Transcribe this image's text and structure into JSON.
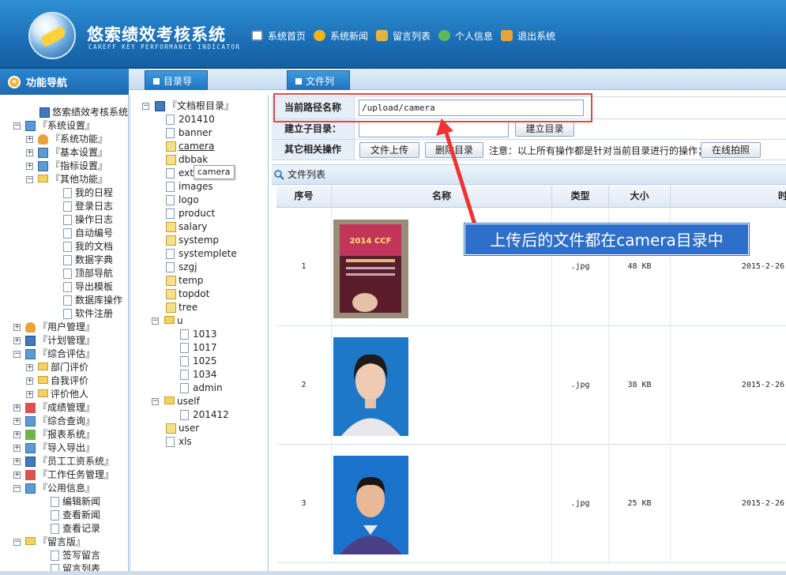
{
  "header": {
    "title": "悠索绩效考核系统",
    "subtitle": "CAREFF KEY PERFORMANCE INDICATOR",
    "nav": [
      {
        "label": "系统首页",
        "icon": "home-icon"
      },
      {
        "label": "系统新闻",
        "icon": "news-icon"
      },
      {
        "label": "留言列表",
        "icon": "message-list-icon"
      },
      {
        "label": "个人信息",
        "icon": "user-info-icon"
      },
      {
        "label": "退出系统",
        "icon": "exit-icon"
      }
    ]
  },
  "nav_panel": {
    "title": "功能导航",
    "items": [
      "悠索绩效考核系统A",
      "『系统设置』",
      "『系统功能』",
      "『基本设置』",
      "『指标设置』",
      "『其他功能』",
      "我的日程",
      "登录日志",
      "操作日志",
      "自动编号",
      "我的文档",
      "数据字典",
      "顶部导航",
      "导出模板",
      "数据库操作",
      "软件注册",
      "『用户管理』",
      "『计划管理』",
      "『综合评估』",
      "部门评价",
      "自我评价",
      "评价他人",
      "『成绩管理』",
      "『综合查询』",
      "『报表系统』",
      "『导入导出』",
      "『员工工资系统』",
      "『工作任务管理』",
      "『公用信息』",
      "编辑新闻",
      "查看新闻",
      "查看记录",
      "『留言版』",
      "签写留言",
      "留言列表"
    ]
  },
  "tabs": {
    "dir_nav": "目录导航",
    "file_list": "文件列表"
  },
  "dir_tree": {
    "root": "『文档根目录』",
    "items": [
      "201410",
      "banner",
      "camera",
      "dbbak",
      "ext",
      "images",
      "logo",
      "product",
      "salary",
      "systemp",
      "systemplete",
      "szgj",
      "temp",
      "topdot",
      "tree",
      "u",
      "1013",
      "1017",
      "1025",
      "1034",
      "admin",
      "uself",
      "201412",
      "user",
      "xls"
    ],
    "tooltip": "camera"
  },
  "form": {
    "path_label": "当前路径名称",
    "path_value": "/upload/camera",
    "mkdir_label": "建立子目录：",
    "mkdir_button": "建立目录",
    "ops_label": "其它相关操作",
    "upload_button": "文件上传",
    "delete_button": "删除目录",
    "note": "注意：以上所有操作都是针对当前目录进行的操作；",
    "camera_button": "在线拍照"
  },
  "file_list": {
    "title": "文件列表",
    "columns": [
      "序号",
      "名称",
      "类型",
      "大小",
      "时"
    ],
    "rows": [
      {
        "no": "1",
        "type": ".jpg",
        "size": "48 KB",
        "date": "2015-2-26"
      },
      {
        "no": "2",
        "type": ".jpg",
        "size": "38 KB",
        "date": "2015-2-26"
      },
      {
        "no": "3",
        "type": ".jpg",
        "size": "25 KB",
        "date": "2015-2-26"
      }
    ],
    "thumb1_title": "2014 CCF"
  },
  "annotation": {
    "text": "上传后的文件都在camera目录中"
  },
  "colors": {
    "header_blue": "#1c6fb6",
    "callout_blue": "#2e6fc9",
    "highlight_red": "#e04848"
  }
}
